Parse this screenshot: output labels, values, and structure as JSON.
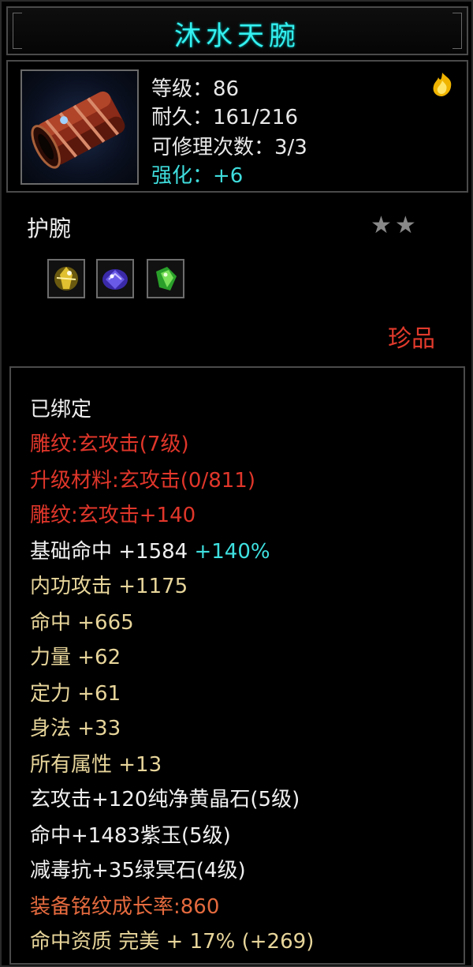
{
  "title": "沐水天腕",
  "stats": {
    "level": "等级：86",
    "durability": "耐久：161/216",
    "repairs": "可修理次数：3/3",
    "enhance": "强化：+6"
  },
  "item_type": "护腕",
  "stars": "★★",
  "quality": "珍品",
  "gems": [
    "yellow-crystal",
    "purple-jade",
    "green-stone"
  ],
  "attributes": {
    "bound": "已绑定",
    "engrave": "雕纹:玄攻击(7级)",
    "upgrade_material": "升级材料:玄攻击(0/811)",
    "engrave_bonus": "雕纹:玄攻击+140",
    "base_hit": "基础命中  +1584",
    "base_hit_bonus": "+140%",
    "internal_attack": "内功攻击  +1175",
    "hit": "命中  +665",
    "strength": "力量  +62",
    "focus": "定力  +61",
    "agility": "身法  +33",
    "all_attr": "所有属性  +13",
    "gem1": "玄攻击+120纯净黄晶石(5级)",
    "gem2": "命中+1483紫玉(5级)",
    "gem3": "减毒抗+35绿冥石(4级)",
    "growth": "装备铭纹成长率:860",
    "aptitude": "命中资质  完美  + 17% (+269)"
  }
}
